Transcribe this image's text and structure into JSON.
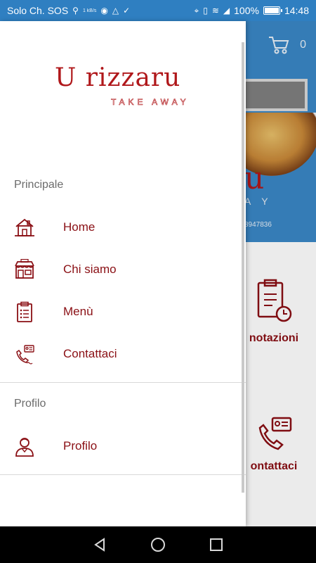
{
  "status_bar": {
    "carrier": "Solo Ch. SOS",
    "small_text": "1 kB/s",
    "battery": "100%",
    "time": "14:48"
  },
  "background_app": {
    "cart_count": "0",
    "brand_fragment": "u",
    "subtitle_fragment": "A Y",
    "phone_fragment": "8947836",
    "card_1_label": "notazioni",
    "card_2_label": "ontattaci"
  },
  "drawer": {
    "logo": {
      "text": "U rizzaru",
      "subtitle": "TAKE AWAY"
    },
    "sections": [
      {
        "title": "Principale",
        "items": [
          {
            "label": "Home",
            "icon": "house-icon"
          },
          {
            "label": "Chi siamo",
            "icon": "store-icon"
          },
          {
            "label": "Menù",
            "icon": "clipboard-icon"
          },
          {
            "label": "Contattaci",
            "icon": "phone-contact-icon"
          }
        ]
      },
      {
        "title": "Profilo",
        "items": [
          {
            "label": "Profilo",
            "icon": "user-icon"
          }
        ]
      }
    ]
  },
  "colors": {
    "accent": "#8a0f14",
    "brand_red": "#b0181b",
    "header_blue": "#3a87c6",
    "status_blue": "#2f7fc1"
  }
}
